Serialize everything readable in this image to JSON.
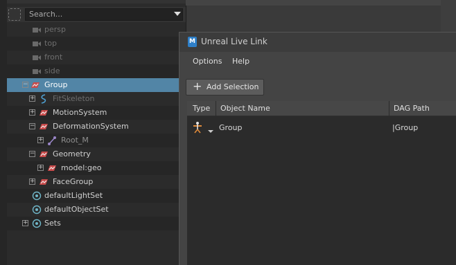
{
  "outliner": {
    "search_placeholder": "Search...",
    "items": [
      {
        "label": "persp"
      },
      {
        "label": "top"
      },
      {
        "label": "front"
      },
      {
        "label": "side"
      },
      {
        "label": "Group"
      },
      {
        "label": "FitSkeleton"
      },
      {
        "label": "MotionSystem"
      },
      {
        "label": "DeformationSystem"
      },
      {
        "label": "Root_M"
      },
      {
        "label": "Geometry"
      },
      {
        "label": "model:geo"
      },
      {
        "label": "FaceGroup"
      },
      {
        "label": "defaultLightSet"
      },
      {
        "label": "defaultObjectSet"
      },
      {
        "label": "Sets"
      }
    ],
    "expand_plus": "+",
    "expand_minus": "−"
  },
  "live_link": {
    "logo_letter": "M",
    "title": "Unreal Live Link",
    "menu": [
      "Options",
      "Help"
    ],
    "add_selection_icon": "+",
    "add_selection_label": "Add Selection",
    "columns": [
      "Type",
      "Object Name",
      "DAG Path"
    ],
    "rows": [
      {
        "type_icon": "joint-icon",
        "name": "Group",
        "dag_path": "|Group"
      }
    ]
  }
}
